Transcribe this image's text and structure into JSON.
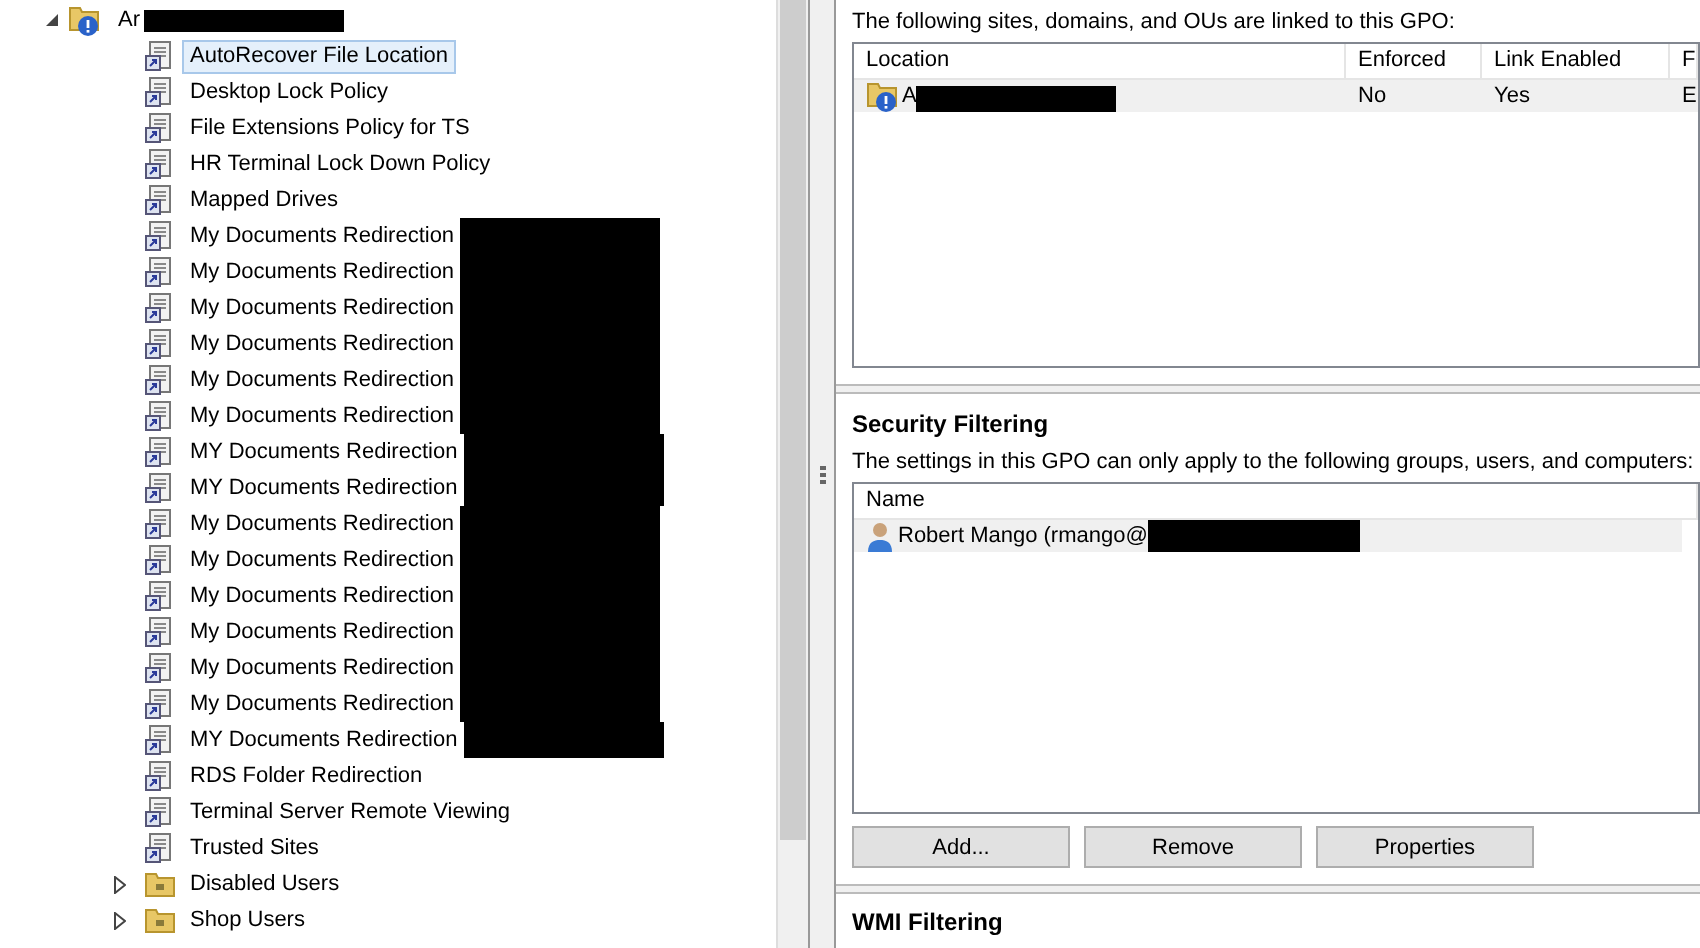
{
  "tree": {
    "root": {
      "label": "Ar",
      "kind": "ou",
      "expanded": true,
      "redacted": true,
      "children": [
        {
          "label": "AutoRecover File Location",
          "kind": "gpo",
          "selected": true,
          "redacted": false
        },
        {
          "label": "Desktop Lock Policy",
          "kind": "gpo",
          "selected": false,
          "redacted": false
        },
        {
          "label": "File Extensions Policy for TS",
          "kind": "gpo",
          "selected": false,
          "redacted": false
        },
        {
          "label": "HR Terminal Lock Down Policy",
          "kind": "gpo",
          "selected": false,
          "redacted": false
        },
        {
          "label": "Mapped Drives",
          "kind": "gpo",
          "selected": false,
          "redacted": false
        },
        {
          "label": "My Documents Redirection",
          "kind": "gpo",
          "selected": false,
          "redacted": true
        },
        {
          "label": "My Documents Redirection",
          "kind": "gpo",
          "selected": false,
          "redacted": true
        },
        {
          "label": "My Documents Redirection",
          "kind": "gpo",
          "selected": false,
          "redacted": true
        },
        {
          "label": "My Documents Redirection",
          "kind": "gpo",
          "selected": false,
          "redacted": true
        },
        {
          "label": "My Documents Redirection",
          "kind": "gpo",
          "selected": false,
          "redacted": true
        },
        {
          "label": "My Documents Redirection",
          "kind": "gpo",
          "selected": false,
          "redacted": true
        },
        {
          "label": "MY Documents Redirection",
          "kind": "gpo",
          "selected": false,
          "redacted": true
        },
        {
          "label": "MY Documents Redirection",
          "kind": "gpo",
          "selected": false,
          "redacted": true
        },
        {
          "label": "My Documents Redirection",
          "kind": "gpo",
          "selected": false,
          "redacted": true
        },
        {
          "label": "My Documents Redirection",
          "kind": "gpo",
          "selected": false,
          "redacted": true
        },
        {
          "label": "My Documents Redirection",
          "kind": "gpo",
          "selected": false,
          "redacted": true
        },
        {
          "label": "My Documents Redirection",
          "kind": "gpo",
          "selected": false,
          "redacted": true
        },
        {
          "label": "My Documents Redirection",
          "kind": "gpo",
          "selected": false,
          "redacted": true
        },
        {
          "label": "My Documents Redirection",
          "kind": "gpo",
          "selected": false,
          "redacted": true
        },
        {
          "label": "MY Documents Redirection",
          "kind": "gpo",
          "selected": false,
          "redacted": true
        },
        {
          "label": "RDS Folder Redirection",
          "kind": "gpo",
          "selected": false,
          "redacted": false
        },
        {
          "label": "Terminal Server Remote Viewing",
          "kind": "gpo",
          "selected": false,
          "redacted": false
        },
        {
          "label": "Trusted Sites",
          "kind": "gpo",
          "selected": false,
          "redacted": false
        },
        {
          "label": "Disabled Users",
          "kind": "folder",
          "expanded": false,
          "selected": false,
          "redacted": false
        },
        {
          "label": "Shop Users",
          "kind": "folder",
          "expanded": false,
          "selected": false,
          "redacted": false
        }
      ]
    }
  },
  "links": {
    "caption": "The following sites, domains, and OUs are linked to this GPO:",
    "columns": [
      "Location",
      "Enforced",
      "Link Enabled",
      "F"
    ],
    "rows": [
      {
        "cells": [
          "A",
          "No",
          "Yes",
          "E"
        ],
        "redacted": true
      }
    ]
  },
  "security": {
    "heading": "Security Filtering",
    "caption": "The settings in this GPO can only apply to the following groups, users, and computers:",
    "columns": [
      "Name"
    ],
    "rows": [
      {
        "name": "Robert Mango (rmango@",
        "redacted": true
      }
    ],
    "buttons": [
      "Add...",
      "Remove",
      "Properties"
    ]
  },
  "wmi": {
    "heading": "WMI Filtering"
  }
}
